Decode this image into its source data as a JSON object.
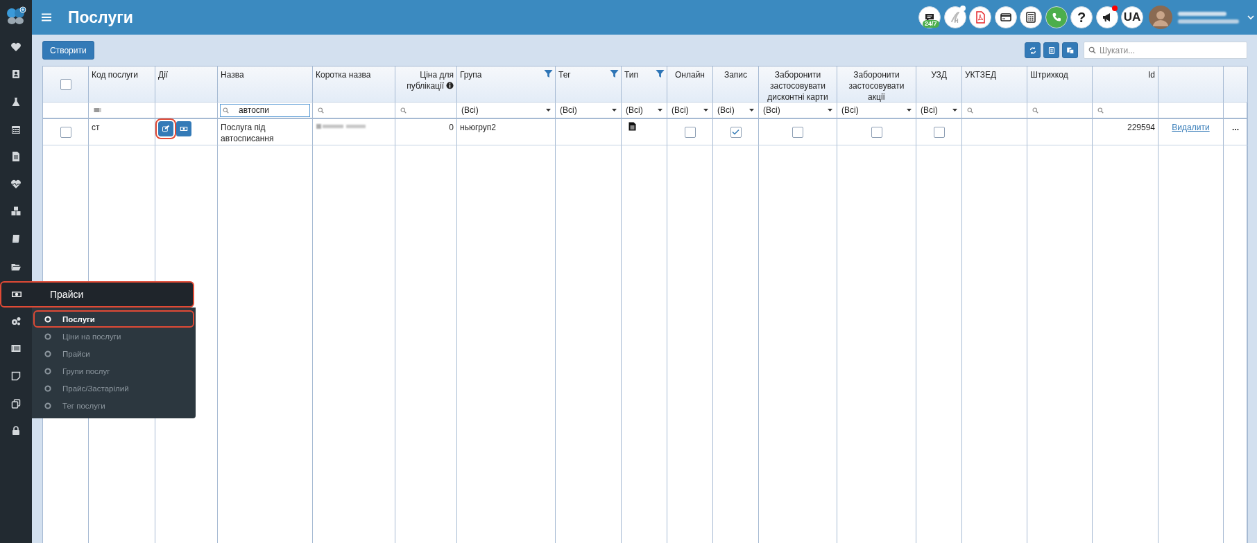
{
  "header": {
    "title": "Послуги"
  },
  "header_buttons": [
    {
      "kind": "chat",
      "badge": "24/7",
      "dot": false
    },
    {
      "kind": "logo",
      "dot": true
    },
    {
      "kind": "pdf",
      "dot": false
    },
    {
      "kind": "card",
      "dot": false
    },
    {
      "kind": "calculator",
      "dot": false
    },
    {
      "kind": "phone",
      "dot": false
    },
    {
      "kind": "help",
      "label": "?",
      "dot": false
    },
    {
      "kind": "megaphone",
      "dot": true
    },
    {
      "kind": "language",
      "label": "UA",
      "dot": false
    }
  ],
  "sidebar": {
    "items": [
      {
        "kind": "heart"
      },
      {
        "kind": "contact"
      },
      {
        "kind": "flask"
      },
      {
        "kind": "calendar"
      },
      {
        "kind": "document"
      },
      {
        "kind": "heartbeat"
      },
      {
        "kind": "cubes"
      },
      {
        "kind": "book"
      },
      {
        "kind": "folder"
      },
      {
        "kind": "gears"
      },
      {
        "kind": "list"
      },
      {
        "kind": "note"
      },
      {
        "kind": "copy"
      },
      {
        "kind": "lock"
      }
    ]
  },
  "flyout": {
    "title": "Прайси",
    "highlighted": true,
    "items": [
      {
        "label": "Послуги",
        "selected": true
      },
      {
        "label": "Ціни на послуги",
        "selected": false
      },
      {
        "label": "Прайси",
        "selected": false
      },
      {
        "label": "Групи послуг",
        "selected": false
      },
      {
        "label": "Прайс/Застарілий",
        "selected": false
      },
      {
        "label": "Тег послуги",
        "selected": false
      }
    ]
  },
  "toolbar": {
    "create_button": "Створити",
    "search": {
      "placeholder": "Шукати..."
    }
  },
  "table": {
    "select_all": {
      "checked": false
    },
    "columns": [
      {
        "filter": {
          "kind": "none"
        }
      },
      {
        "label": "Код послуги",
        "filter": {
          "kind": "code"
        }
      },
      {
        "label": "Дії",
        "filter": {
          "kind": "none"
        }
      },
      {
        "label": "Назва",
        "filter": {
          "kind": "text",
          "value": "автоспи"
        }
      },
      {
        "label": "Коротка назва",
        "filter": {
          "kind": "text"
        }
      },
      {
        "label": "Ціна для публікації",
        "info": true,
        "filter": {
          "kind": "text"
        }
      },
      {
        "label": "Група",
        "funnel": true,
        "filter": {
          "kind": "select",
          "value": "(Всі)"
        }
      },
      {
        "label": "Тег",
        "funnel": true,
        "filter": {
          "kind": "select",
          "value": "(Всі)"
        }
      },
      {
        "label": "Тип",
        "funnel": true,
        "filter": {
          "kind": "select",
          "value": "(Всі)"
        }
      },
      {
        "label": "Онлайн",
        "filter": {
          "kind": "select",
          "value": "(Всі)"
        }
      },
      {
        "label": "Запис",
        "filter": {
          "kind": "select",
          "value": "(Всі)"
        }
      },
      {
        "label": "Заборонити застосовувати дисконтні карти",
        "filter": {
          "kind": "select",
          "value": "(Всі)"
        }
      },
      {
        "label": "Заборонити застосовувати акції",
        "filter": {
          "kind": "select",
          "value": "(Всі)"
        }
      },
      {
        "label": "УЗД",
        "filter": {
          "kind": "select",
          "value": "(Всі)"
        }
      },
      {
        "label": "УКТЗЕД",
        "filter": {
          "kind": "text"
        }
      },
      {
        "label": "Штрихкод",
        "filter": {
          "kind": "text"
        }
      },
      {
        "label": "Id",
        "filter": {
          "kind": "text"
        }
      },
      {
        "filter": {
          "kind": "none"
        }
      },
      {
        "filter": {
          "kind": "none"
        }
      }
    ],
    "rows": [
      {
        "cells": [
          {
            "kind": "checkbox",
            "checked": false
          },
          {
            "kind": "text",
            "text": "ст"
          },
          {
            "kind": "actions",
            "buttons": [
              {
                "kind": "edit",
                "highlighted": true
              },
              {
                "kind": "money",
                "highlighted": false
              }
            ]
          },
          {
            "kind": "text",
            "text": "Послуга під автосписання"
          },
          {
            "kind": "blurred"
          },
          {
            "kind": "text",
            "text": "0"
          },
          {
            "kind": "text",
            "text": "ньюгруп2"
          },
          {
            "kind": "empty"
          },
          {
            "kind": "doc"
          },
          {
            "kind": "checkbox",
            "checked": false
          },
          {
            "kind": "checkbox",
            "checked": true
          },
          {
            "kind": "checkbox",
            "checked": false
          },
          {
            "kind": "checkbox",
            "checked": false
          },
          {
            "kind": "checkbox",
            "checked": false
          },
          {
            "kind": "empty"
          },
          {
            "kind": "empty"
          },
          {
            "kind": "text",
            "text": "229594"
          },
          {
            "kind": "link",
            "text": "Видалити"
          },
          {
            "kind": "text",
            "text": "..."
          }
        ]
      }
    ]
  }
}
